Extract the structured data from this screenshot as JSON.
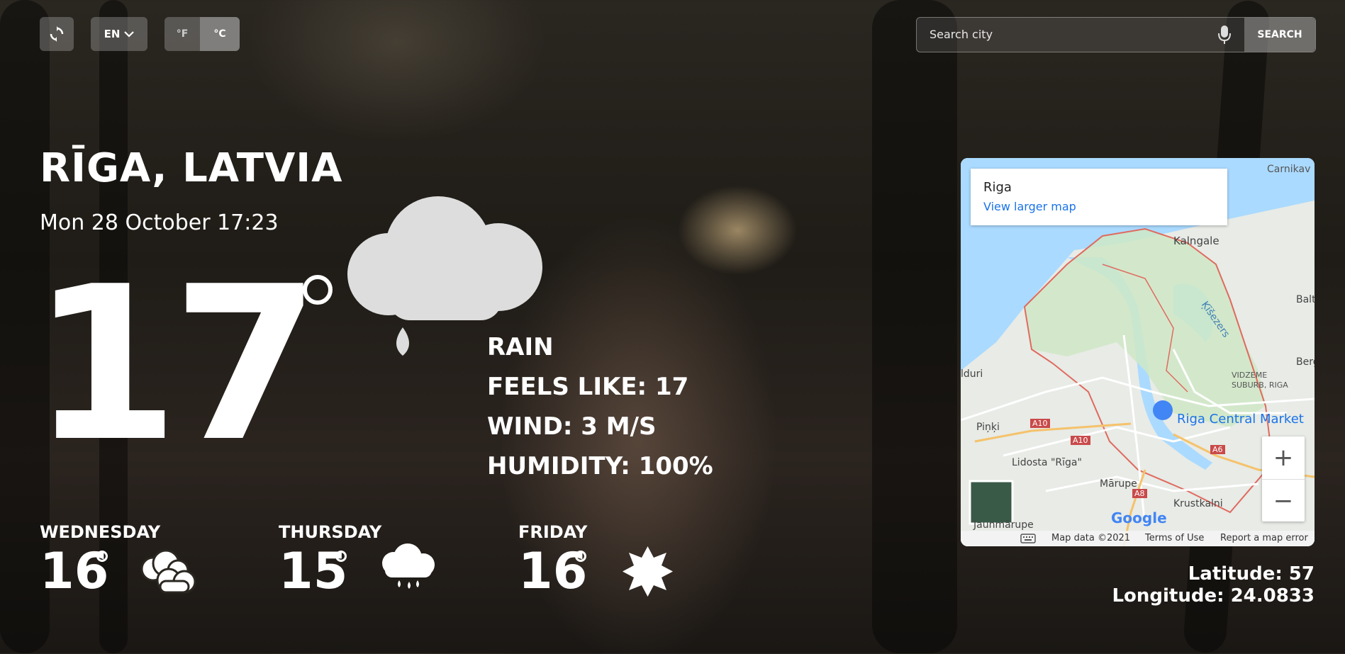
{
  "toolbar": {
    "refresh_icon": "refresh-icon",
    "language": "EN",
    "unit_f": "°F",
    "unit_c": "°C",
    "search_placeholder": "Search city",
    "mic_icon": "microphone-icon",
    "search_label": "SEARCH"
  },
  "location": {
    "city": "RĪGA, LATVIA",
    "datetime": "Mon 28 October 17:23"
  },
  "current": {
    "temperature": "17",
    "icon": "rain-cloud-icon",
    "condition": "RAIN",
    "feels_like": "FEELS LIKE: 17",
    "wind": "WIND: 3 M/S",
    "humidity": "HUMIDITY: 100%"
  },
  "forecast": [
    {
      "day": "WEDNESDAY",
      "temp": "16",
      "icon": "partly-cloudy-icon"
    },
    {
      "day": "THURSDAY",
      "temp": "15",
      "icon": "rain-icon"
    },
    {
      "day": "FRIDAY",
      "temp": "16",
      "icon": "sun-icon"
    }
  ],
  "map": {
    "title": "Riga",
    "link": "View larger map",
    "labels": {
      "carnikava": "Carnikav",
      "kalngale": "Kalngale",
      "balt": "Balt",
      "kisezers": "Ķīšezers",
      "berg": "Berg",
      "lduri": "lduri",
      "vidzeme": "VIDZEME",
      "suburb": "SUBURB, RIGA",
      "market": "Riga Central Market",
      "pinki": "Piņķi",
      "a10a": "A10",
      "a10b": "A10",
      "a6": "A6",
      "a8": "A8",
      "lidosta": "Lidosta \"Rīga\"",
      "marupe": "Mārupe",
      "krustkalni": "Krustkalni",
      "jaunmarupe": "Jaunmārupe",
      "google": "Google"
    },
    "footer": {
      "data": "Map data ©2021",
      "terms": "Terms of Use",
      "report": "Report a map error"
    },
    "zoom_in": "+",
    "zoom_out": "−"
  },
  "coordinates": {
    "latitude": "Latitude: 57",
    "longitude": "Longitude: 24.0833"
  },
  "colors": {
    "map_water": "#aadaff",
    "map_land": "#cfe8c6",
    "map_boundary": "#e06a5f",
    "link_blue": "#1a73e8"
  }
}
